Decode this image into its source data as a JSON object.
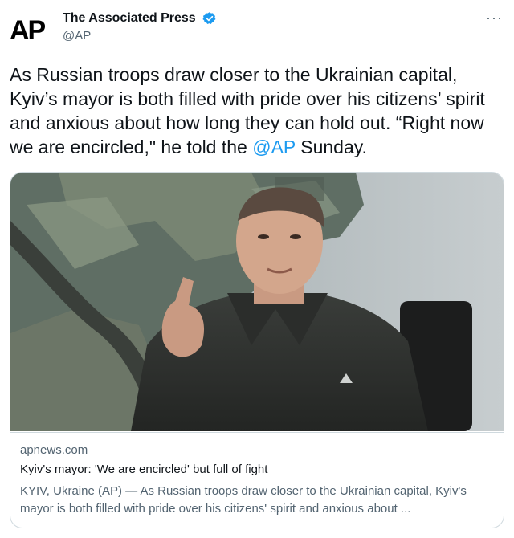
{
  "author": {
    "logo_text": "AP",
    "display_name": "The Associated Press",
    "handle": "@AP",
    "verified_color": "#1d9bf0"
  },
  "more_label": "···",
  "tweet": {
    "text_before": "As Russian troops draw closer to the Ukrainian capital, Kyiv’s mayor is both filled with pride over his citizens’ spirit and anxious about how long they can hold out. “Right now we are encircled,\" he told the ",
    "mention": "@AP",
    "text_after": " Sunday."
  },
  "card": {
    "image_icon": "photo-man-pointing-in-front-of-map",
    "domain": "apnews.com",
    "title": "Kyiv's mayor: 'We are encircled' but full of fight",
    "description": "KYIV, Ukraine (AP) — As Russian troops draw closer to the Ukrainian capital, Kyiv's mayor is both filled with pride over his citizens' spirit and anxious about ..."
  },
  "colors": {
    "text": "#0f1419",
    "secondary": "#536471",
    "link": "#1d9bf0",
    "border": "#cfd9de"
  }
}
